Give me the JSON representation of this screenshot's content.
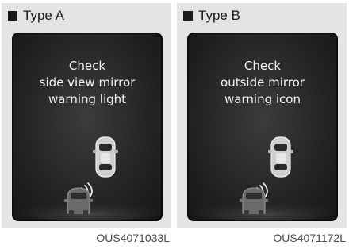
{
  "panels": [
    {
      "type_label": "Type A",
      "message": [
        "Check",
        "side view mirror",
        "warning light"
      ],
      "code": "OUS4071033L"
    },
    {
      "type_label": "Type B",
      "message": [
        "Check",
        "outside mirror",
        "warning icon"
      ],
      "code": "OUS4071172L"
    }
  ],
  "colors": {
    "screen_bg": "#262626",
    "text": "#f2f2f2",
    "car_light": "#d8d8d8",
    "car_dark": "#6a6a6a"
  },
  "icons": [
    "square-bullet-icon",
    "vehicle-front-icon",
    "vehicle-rear-icon",
    "signal-waves-icon"
  ]
}
